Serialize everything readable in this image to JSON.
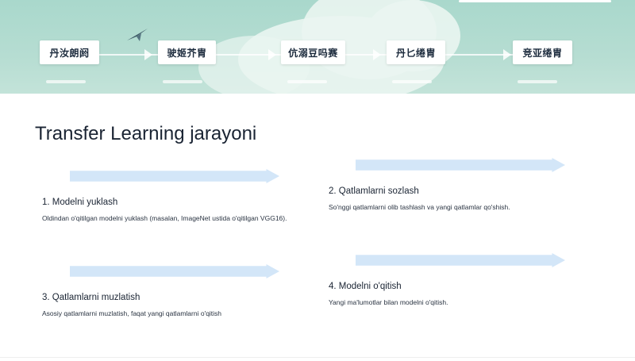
{
  "hero": {
    "stages": [
      {
        "label": "丹汝朗阏"
      },
      {
        "label": "驶姬芥胄"
      },
      {
        "label": "伉溺豆吗赛"
      },
      {
        "label": "丹匕绻胄"
      },
      {
        "label": "竞亚绻胄"
      }
    ]
  },
  "main": {
    "title": "Transfer Learning jarayoni",
    "steps": [
      {
        "title": "1. Modelni yuklash",
        "desc": "Oldindan o'qitilgan modelni yuklash (masalan, ImageNet ustida o'qitilgan VGG16)."
      },
      {
        "title": "2. Qatlamlarni sozlash",
        "desc": "So'nggi qatlamlarni olib tashlash va yangi qatlamlar qo'shish."
      },
      {
        "title": "3. Qatlamlarni muzlatish",
        "desc": "Asosiy qatlamlarni muzlatish, faqat yangi qatlamlarni o'qitish"
      },
      {
        "title": "4. Modelni o'qitish",
        "desc": "Yangi ma'lumotlar bilan modelni o'qitish."
      }
    ]
  },
  "colors": {
    "band": "#d3e6f8",
    "hero": "#b6ddd2"
  },
  "icons": {
    "plane": "paper-plane-icon"
  }
}
